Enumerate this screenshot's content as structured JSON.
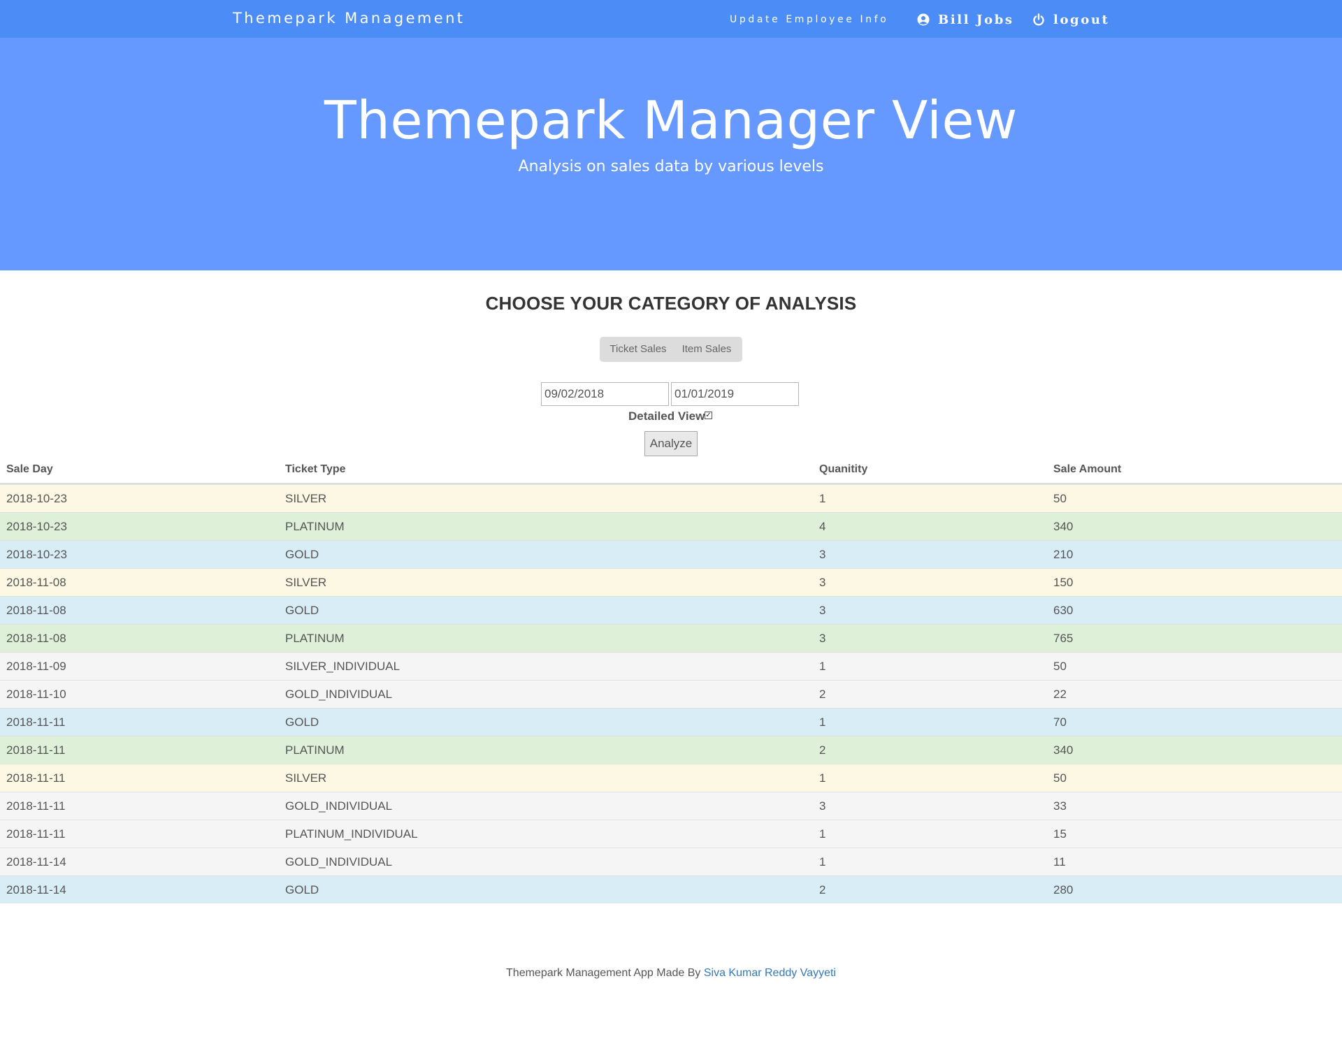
{
  "navbar": {
    "brand": "Themepark Management",
    "update_link": "Update Employee Info",
    "user_name": "Bill Jobs",
    "logout": "logout",
    "color": "#4b8cf7"
  },
  "hero": {
    "title": "Themepark Manager View",
    "subtitle": "Analysis on sales data by various levels",
    "color": "#6699ff"
  },
  "analysis": {
    "heading": "CHOOSE YOUR CATEGORY OF ANALYSIS",
    "tabs": [
      "Ticket Sales",
      "Item Sales"
    ],
    "date_from": "09/02/2018",
    "date_to": "01/01/2019",
    "detailed_label": "Detailed View",
    "detailed_checked": true,
    "analyze_label": "Analyze"
  },
  "table": {
    "headers": [
      "Sale Day",
      "Ticket Type",
      "Quanitity",
      "Sale Amount"
    ],
    "rows": [
      {
        "day": "2018-10-23",
        "type": "SILVER",
        "qty": "1",
        "amount": "50",
        "style": "warning"
      },
      {
        "day": "2018-10-23",
        "type": "PLATINUM",
        "qty": "4",
        "amount": "340",
        "style": "success"
      },
      {
        "day": "2018-10-23",
        "type": "GOLD",
        "qty": "3",
        "amount": "210",
        "style": "info"
      },
      {
        "day": "2018-11-08",
        "type": "SILVER",
        "qty": "3",
        "amount": "150",
        "style": "warning"
      },
      {
        "day": "2018-11-08",
        "type": "GOLD",
        "qty": "3",
        "amount": "630",
        "style": "info"
      },
      {
        "day": "2018-11-08",
        "type": "PLATINUM",
        "qty": "3",
        "amount": "765",
        "style": "success"
      },
      {
        "day": "2018-11-09",
        "type": "SILVER_INDIVIDUAL",
        "qty": "1",
        "amount": "50",
        "style": "active"
      },
      {
        "day": "2018-11-10",
        "type": "GOLD_INDIVIDUAL",
        "qty": "2",
        "amount": "22",
        "style": "active"
      },
      {
        "day": "2018-11-11",
        "type": "GOLD",
        "qty": "1",
        "amount": "70",
        "style": "info"
      },
      {
        "day": "2018-11-11",
        "type": "PLATINUM",
        "qty": "2",
        "amount": "340",
        "style": "success"
      },
      {
        "day": "2018-11-11",
        "type": "SILVER",
        "qty": "1",
        "amount": "50",
        "style": "warning"
      },
      {
        "day": "2018-11-11",
        "type": "GOLD_INDIVIDUAL",
        "qty": "3",
        "amount": "33",
        "style": "active"
      },
      {
        "day": "2018-11-11",
        "type": "PLATINUM_INDIVIDUAL",
        "qty": "1",
        "amount": "15",
        "style": "active"
      },
      {
        "day": "2018-11-14",
        "type": "GOLD_INDIVIDUAL",
        "qty": "1",
        "amount": "11",
        "style": "active"
      },
      {
        "day": "2018-11-14",
        "type": "GOLD",
        "qty": "2",
        "amount": "280",
        "style": "info"
      }
    ]
  },
  "footer": {
    "text": "Themepark Management App Made By ",
    "author": "Siva Kumar Reddy Vayyeti"
  }
}
